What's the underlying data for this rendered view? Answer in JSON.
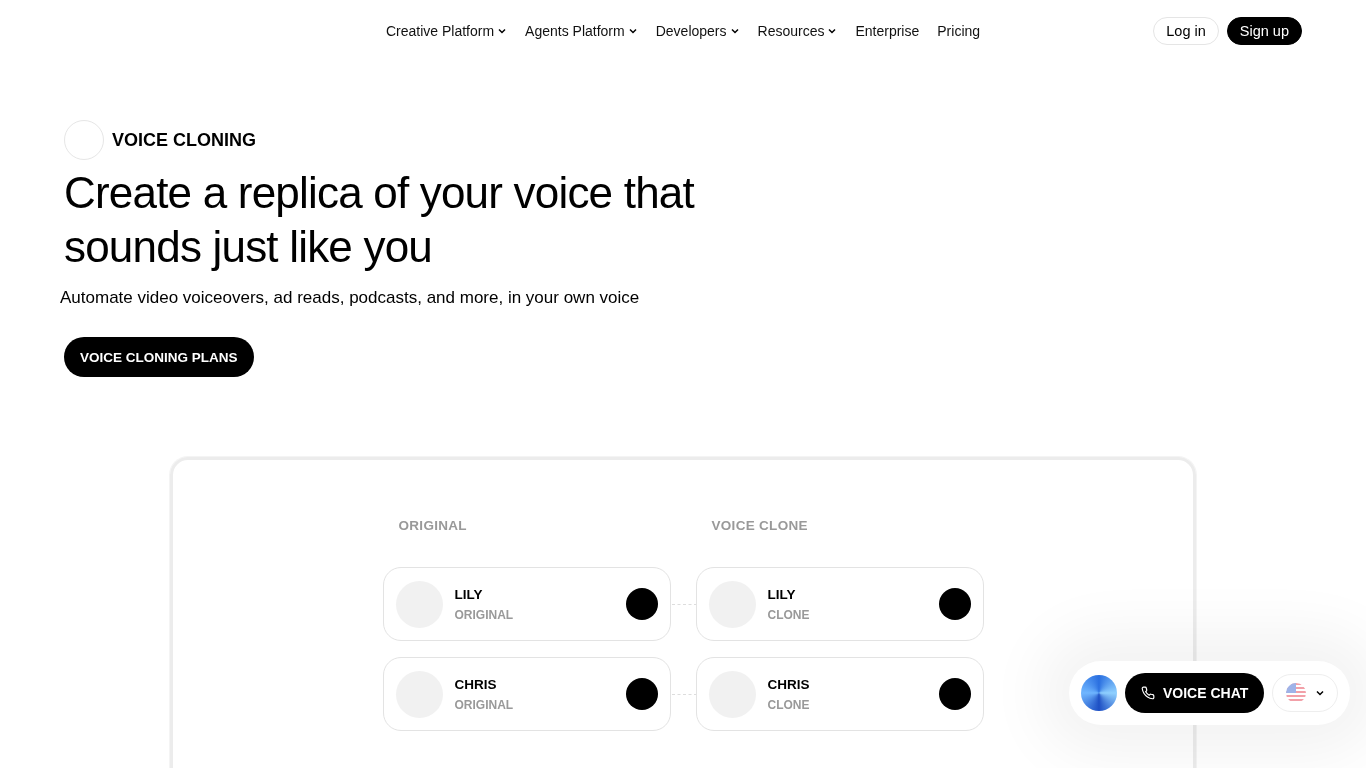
{
  "nav": {
    "links": [
      {
        "label": "Creative Platform",
        "has_menu": true
      },
      {
        "label": "Agents Platform",
        "has_menu": true
      },
      {
        "label": "Developers",
        "has_menu": true
      },
      {
        "label": "Resources",
        "has_menu": true
      },
      {
        "label": "Enterprise",
        "has_menu": false
      },
      {
        "label": "Pricing",
        "has_menu": false
      }
    ],
    "login": "Log in",
    "signup": "Sign up"
  },
  "hero": {
    "eyebrow": "VOICE CLONING",
    "title": "Create a replica of your voice that sounds just like you",
    "subtitle": "Automate video voiceovers, ad reads, podcasts, and more, in your own voice",
    "cta": "VOICE CLONING PLANS"
  },
  "comparison": {
    "columns": [
      "ORIGINAL",
      "VOICE CLONE"
    ],
    "rows": [
      {
        "original": {
          "name": "LILY",
          "tag": "ORIGINAL"
        },
        "clone": {
          "name": "LILY",
          "tag": "CLONE"
        }
      },
      {
        "original": {
          "name": "CHRIS",
          "tag": "ORIGINAL"
        },
        "clone": {
          "name": "CHRIS",
          "tag": "CLONE"
        }
      }
    ]
  },
  "widget": {
    "button": "VOICE CHAT"
  }
}
